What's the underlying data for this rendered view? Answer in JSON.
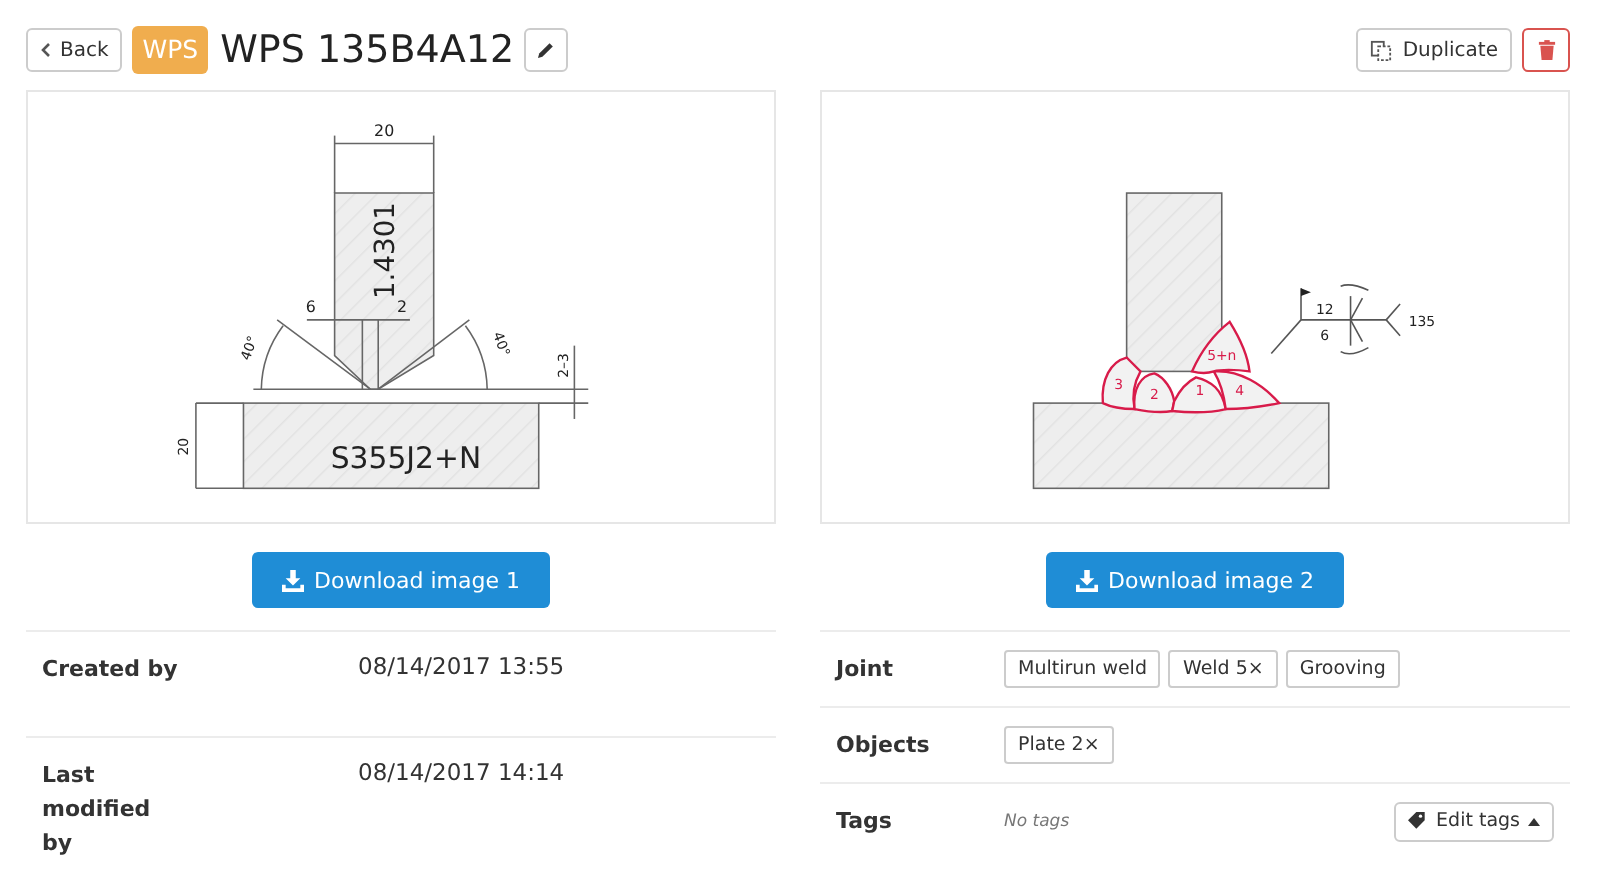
{
  "header": {
    "back": "Back",
    "badge": "WPS",
    "title": "WPS 135B4A12",
    "duplicate": "Duplicate"
  },
  "images": [
    {
      "kind": "groove",
      "labels": [
        "20",
        "1.4301",
        "6",
        "2",
        "40°",
        "40°",
        "2–3",
        "20",
        "S355J2+N"
      ],
      "button": "Download image 1"
    },
    {
      "kind": "fillet",
      "labels": [
        "3",
        "2",
        "1",
        "4",
        "5+n",
        "12",
        "6",
        "135"
      ],
      "button": "Download image 2"
    }
  ],
  "details": [
    {
      "label": "Created by",
      "value": "08/14/2017 13:55"
    },
    {
      "label": "Last modified by",
      "value": "08/14/2017 14:14"
    }
  ],
  "properties": [
    {
      "kind": "tags",
      "label": "Joint",
      "tags": [
        "Multirun weld",
        "Weld 5×",
        "Grooving"
      ]
    },
    {
      "kind": "tags",
      "label": "Objects",
      "tags": [
        "Plate 2×"
      ]
    },
    {
      "kind": "empty",
      "label": "Tags",
      "empty": "No tags",
      "button": "Edit tags"
    }
  ]
}
